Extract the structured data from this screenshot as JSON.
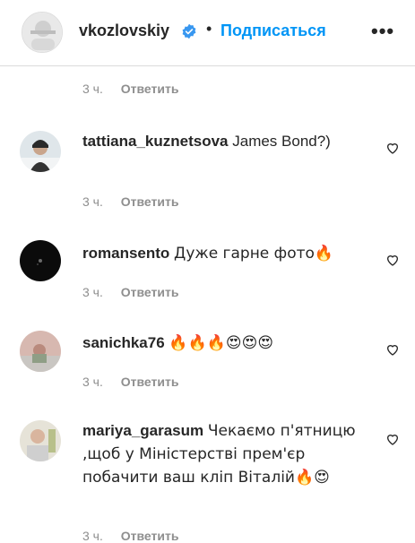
{
  "header": {
    "username": "vkozlovskiy",
    "separator": "•",
    "follow_label": "Подписаться",
    "more_label": "•••"
  },
  "comments": [
    {
      "time": "3 ч.",
      "reply_label": "Ответить"
    },
    {
      "username": "tattiana_kuznetsova",
      "text": "James Bond?)",
      "time": "3 ч.",
      "reply_label": "Ответить"
    },
    {
      "username": "romansento",
      "text": "Дуже гарне фото🔥",
      "time": "3 ч.",
      "reply_label": "Ответить"
    },
    {
      "username": "sanichka76",
      "text": "🔥🔥🔥😍😍😍",
      "time": "3 ч.",
      "reply_label": "Ответить"
    },
    {
      "username": "mariya_garasum",
      "text": "Чекаємо п'ятницю ,щоб у Міністерстві прем'єр побачити ваш кліп Віталій🔥😍",
      "time": "3 ч.",
      "reply_label": "Ответить"
    }
  ],
  "colors": {
    "accent": "#0095f6",
    "text": "#262626",
    "secondary": "#8e8e8e",
    "divider": "#dbdbdb"
  },
  "icons": [
    "verified-badge-icon",
    "heart-outline-icon",
    "more-options-icon"
  ]
}
